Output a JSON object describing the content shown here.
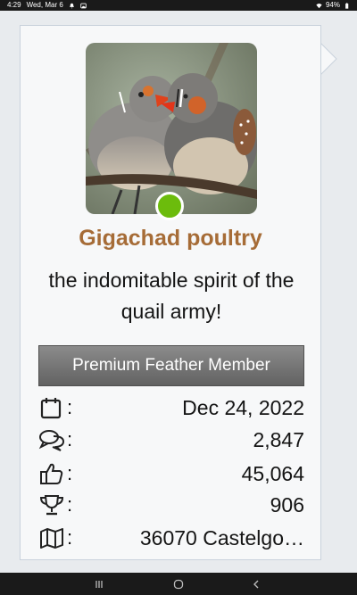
{
  "status_bar": {
    "time": "4:29",
    "date": "Wed, Mar 6",
    "battery": "94%"
  },
  "profile": {
    "username": "Gigachad poultry",
    "tagline": "the indomitable spirit of the quail army!",
    "rank": "Premium Feather Member",
    "online_color": "#6cbc0c",
    "username_color": "#a66c37"
  },
  "stats": [
    {
      "icon": "calendar-icon",
      "colon": ":",
      "value": "Dec 24, 2022"
    },
    {
      "icon": "messages-icon",
      "colon": ":",
      "value": "2,847"
    },
    {
      "icon": "thumbs-up-icon",
      "colon": ":",
      "value": "45,064"
    },
    {
      "icon": "trophy-icon",
      "colon": ":",
      "value": "906"
    },
    {
      "icon": "map-icon",
      "colon": ":",
      "value": "36070 Castelgo…"
    }
  ]
}
